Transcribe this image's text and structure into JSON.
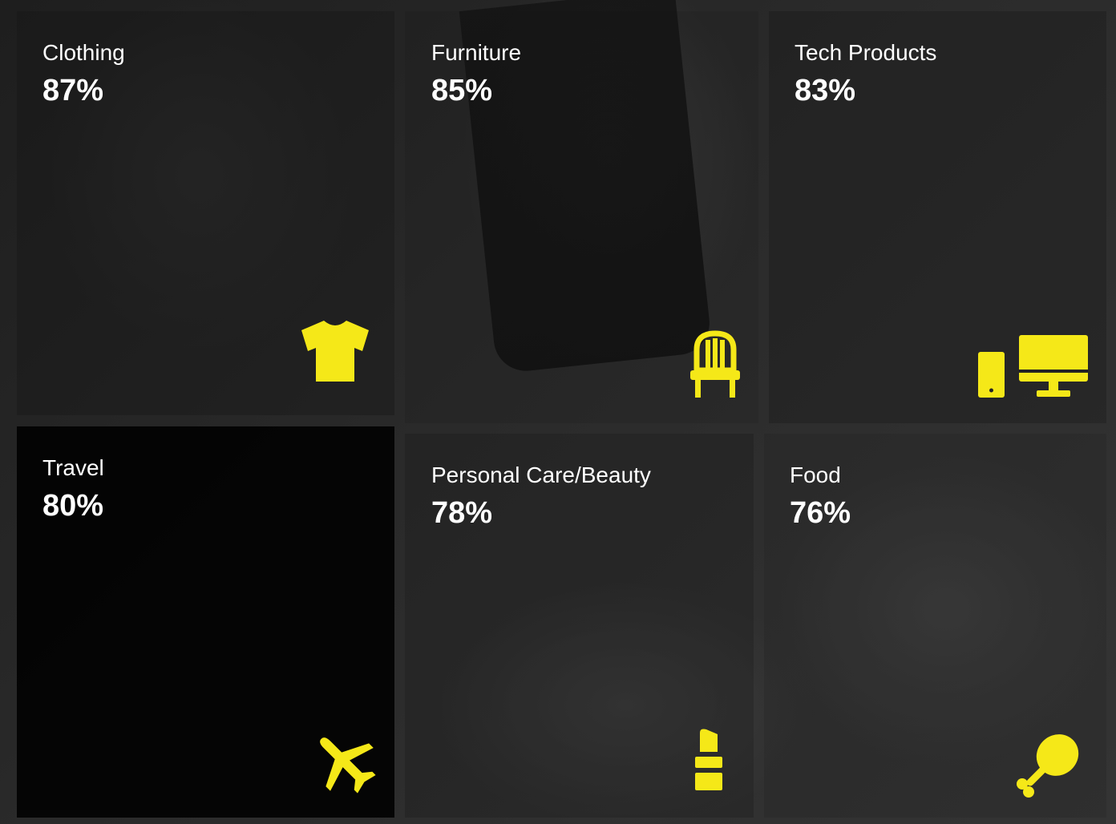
{
  "accent_color": "#f5e818",
  "tiles": [
    {
      "name": "Clothing",
      "value": "87%",
      "icon": "tshirt-icon"
    },
    {
      "name": "Furniture",
      "value": "85%",
      "icon": "chair-icon"
    },
    {
      "name": "Tech Products",
      "value": "83%",
      "icon": "devices-icon"
    },
    {
      "name": "Travel",
      "value": "80%",
      "icon": "airplane-icon"
    },
    {
      "name": "Personal Care/Beauty",
      "value": "78%",
      "icon": "lipstick-icon"
    },
    {
      "name": "Food",
      "value": "76%",
      "icon": "chicken-leg-icon"
    }
  ]
}
